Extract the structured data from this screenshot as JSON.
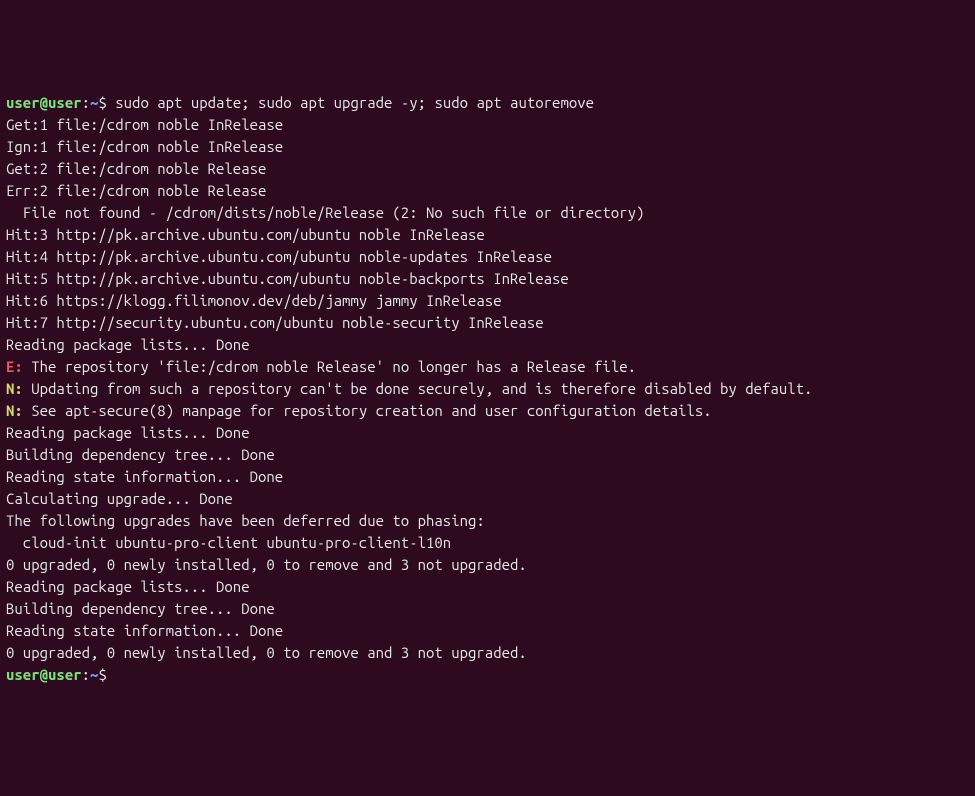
{
  "prompt": {
    "user": "user",
    "host": "user",
    "path": "~",
    "symbol": "$"
  },
  "commands": {
    "line1": "sudo apt update; sudo apt upgrade -y; sudo apt autoremove"
  },
  "output": {
    "l01": "Get:1 file:/cdrom noble InRelease",
    "l02": "Ign:1 file:/cdrom noble InRelease",
    "l03": "Get:2 file:/cdrom noble Release",
    "l04": "Err:2 file:/cdrom noble Release",
    "l05": "  File not found - /cdrom/dists/noble/Release (2: No such file or directory)",
    "l06": "Hit:3 http://pk.archive.ubuntu.com/ubuntu noble InRelease",
    "l07": "Hit:4 http://pk.archive.ubuntu.com/ubuntu noble-updates InRelease",
    "l08": "Hit:5 http://pk.archive.ubuntu.com/ubuntu noble-backports InRelease",
    "l09": "Hit:6 https://klogg.filimonov.dev/deb/jammy jammy InRelease",
    "l10": "Hit:7 http://security.ubuntu.com/ubuntu noble-security InRelease",
    "l11": "Reading package lists... Done",
    "l12_prefix": "E:",
    "l12": " The repository 'file:/cdrom noble Release' no longer has a Release file.",
    "l13_prefix": "N:",
    "l13": " Updating from such a repository can't be done securely, and is therefore disabled by default.",
    "l14_prefix": "N:",
    "l14": " See apt-secure(8) manpage for repository creation and user configuration details.",
    "l15": "Reading package lists... Done",
    "l16": "Building dependency tree... Done",
    "l17": "Reading state information... Done",
    "l18": "Calculating upgrade... Done",
    "l19": "The following upgrades have been deferred due to phasing:",
    "l20": "  cloud-init ubuntu-pro-client ubuntu-pro-client-l10n",
    "l21": "0 upgraded, 0 newly installed, 0 to remove and 3 not upgraded.",
    "l22": "Reading package lists... Done",
    "l23": "Building dependency tree... Done",
    "l24": "Reading state information... Done",
    "l25": "0 upgraded, 0 newly installed, 0 to remove and 3 not upgraded."
  }
}
